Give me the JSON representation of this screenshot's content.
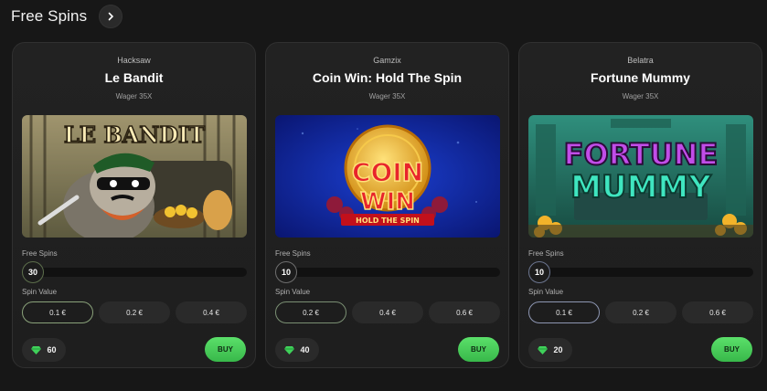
{
  "section": {
    "title": "Free Spins",
    "arrow_icon": "chevron-right-icon"
  },
  "cards": [
    {
      "provider": "Hacksaw",
      "title": "Le Bandit",
      "wager": "Wager 35X",
      "thumb_text": "LE BANDIT",
      "free_spins_label": "Free Spins",
      "free_spins_value": "30",
      "spin_value_label": "Spin Value",
      "spin_values": [
        "0.1 €",
        "0.2 €",
        "0.4 €"
      ],
      "selected_value": "0.1 €",
      "gems": "60",
      "buy_label": "BUY"
    },
    {
      "provider": "Gamzix",
      "title": "Coin Win: Hold The Spin",
      "wager": "Wager 35X",
      "thumb_text_1": "COIN",
      "thumb_text_2": "WIN",
      "thumb_text_3": "HOLD THE SPIN",
      "free_spins_label": "Free Spins",
      "free_spins_value": "10",
      "spin_value_label": "Spin Value",
      "spin_values": [
        "0.2 €",
        "0.4 €",
        "0.6 €"
      ],
      "selected_value": "0.2 €",
      "gems": "40",
      "buy_label": "BUY"
    },
    {
      "provider": "Belatra",
      "title": "Fortune Mummy",
      "wager": "Wager 35X",
      "thumb_text_1": "FORTUNE",
      "thumb_text_2": "MUMMY",
      "free_spins_label": "Free Spins",
      "free_spins_value": "10",
      "spin_value_label": "Spin Value",
      "spin_values": [
        "0.1 €",
        "0.2 €",
        "0.6 €"
      ],
      "selected_value": "0.1 €",
      "gems": "20",
      "buy_label": "BUY"
    }
  ],
  "colors": {
    "buy_green": "#4ccd5c",
    "gem_green": "#3fd15a",
    "background": "#171717"
  }
}
